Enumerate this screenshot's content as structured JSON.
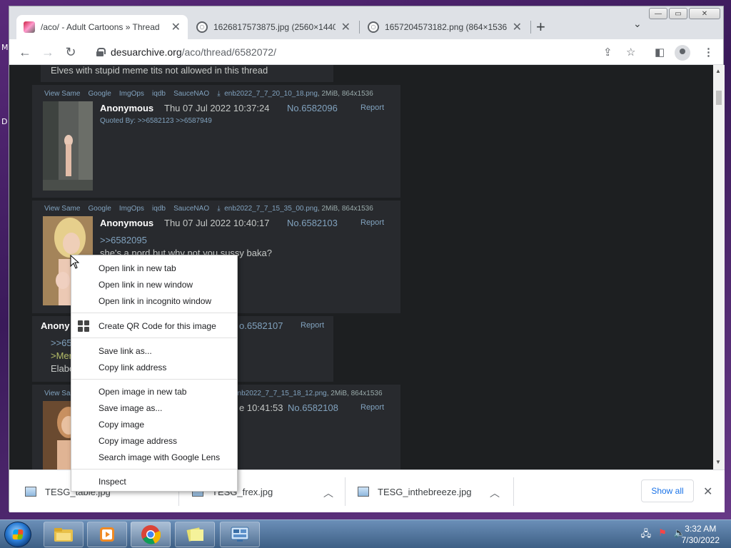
{
  "browser": {
    "tabs": [
      {
        "title": "/aco/ - Adult Cartoons » Thread",
        "active": true
      },
      {
        "title": "1626817573875.jpg (2560×1440)",
        "active": false
      },
      {
        "title": "1657204573182.png (864×1536)",
        "active": false
      }
    ],
    "url_host": "desuarchive.org",
    "url_path": "/aco/thread/6582072/"
  },
  "page": {
    "top_text": "Elves with stupid meme tits not allowed in this thread",
    "posts": [
      {
        "links": [
          "View Same",
          "Google",
          "ImgOps",
          "iqdb",
          "SauceNAO"
        ],
        "filename": "enb2022_7_7_20_10_18.png",
        "fileinfo": ", 2MiB, 864x1536",
        "name": "Anonymous",
        "date": "Thu 07 Jul 2022 10:37:24",
        "no": "No.6582096",
        "report": "Report",
        "quoted_by": "Quoted By: >>6582123 >>6587949"
      },
      {
        "links": [
          "View Same",
          "Google",
          "ImgOps",
          "iqdb",
          "SauceNAO"
        ],
        "filename": "enb2022_7_7_15_35_00.png",
        "fileinfo": ", 2MiB, 864x1536",
        "name": "Anonymous",
        "date": "Thu 07 Jul 2022 10:40:17",
        "no": "No.6582103",
        "report": "Report",
        "line1": ">>6582095",
        "line2": "she's a nord but why not you sussy baka?"
      },
      {
        "name": "Anony",
        "no": "o.6582107",
        "report": "Report",
        "line1": ">>65",
        "line2": ">Mer",
        "line3": "Elabo"
      },
      {
        "links": [
          "View Sa"
        ],
        "filename": "enb2022_7_7_15_18_12.png",
        "fileinfo": ", 2MiB, 864x1536",
        "date": "e 10:41:53",
        "no": "No.6582108",
        "report": "Report"
      }
    ]
  },
  "context_menu": {
    "items": [
      "Open link in new tab",
      "Open link in new window",
      "Open link in incognito window",
      "Create QR Code for this image",
      "Save link as...",
      "Copy link address",
      "Open image in new tab",
      "Save image as...",
      "Copy image",
      "Copy image address",
      "Search image with Google Lens",
      "Inspect"
    ]
  },
  "downloads": {
    "items": [
      "TESG_table.jpg",
      "TESG_frex.jpg",
      "TESG_inthebreeze.jpg"
    ],
    "show_all": "Show all"
  },
  "taskbar": {
    "time": "3:32 AM",
    "date": "7/30/2022"
  },
  "desktop": {
    "edge_letters": [
      "M",
      "D"
    ]
  }
}
